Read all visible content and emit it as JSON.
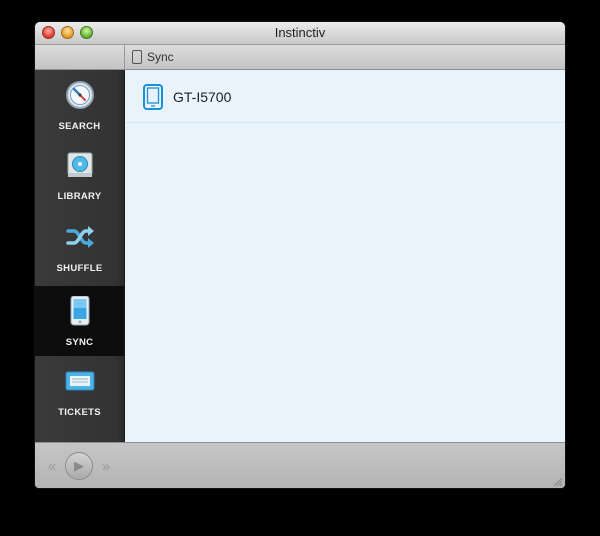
{
  "window": {
    "title": "Instinctiv"
  },
  "toolbar": {
    "breadcrumb": {
      "icon": "phone-icon",
      "label": "Sync"
    }
  },
  "sidebar": {
    "items": [
      {
        "label": "SEARCH",
        "icon": "compass-icon",
        "active": false
      },
      {
        "label": "LIBRARY",
        "icon": "library-icon",
        "active": false
      },
      {
        "label": "SHUFFLE",
        "icon": "shuffle-icon",
        "active": false
      },
      {
        "label": "SYNC",
        "icon": "device-icon",
        "active": true
      },
      {
        "label": "TICKETS",
        "icon": "ticket-icon",
        "active": false
      }
    ]
  },
  "content": {
    "devices": [
      {
        "name": "GT-I5700",
        "icon": "phone-icon"
      }
    ]
  },
  "playback": {
    "rewind": "«",
    "play": "▶",
    "forward": "»"
  },
  "colors": {
    "accent": "#1b8fd6",
    "sidebar": "#333333",
    "content_bg": "#e8f3fb"
  }
}
